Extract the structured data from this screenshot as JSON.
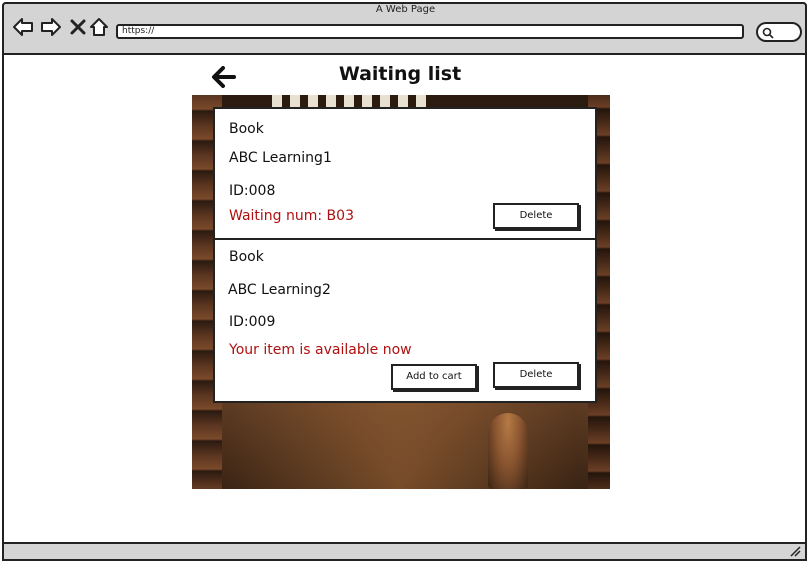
{
  "browser": {
    "window_title": "A Web Page",
    "url": "https://"
  },
  "page": {
    "title": "Waiting list"
  },
  "items": [
    {
      "category": "Book",
      "name": "ABC Learning1",
      "id": "ID:008",
      "status": "Waiting num: B03",
      "delete_label": "Delete"
    },
    {
      "category": "Book",
      "name": "ABC Learning2",
      "id": "ID:009",
      "status": "Your item is available now",
      "add_to_cart_label": "Add to cart",
      "delete_label": "Delete"
    }
  ],
  "colors": {
    "status_text": "#b01010",
    "chrome_gray": "#d4d4d4"
  }
}
